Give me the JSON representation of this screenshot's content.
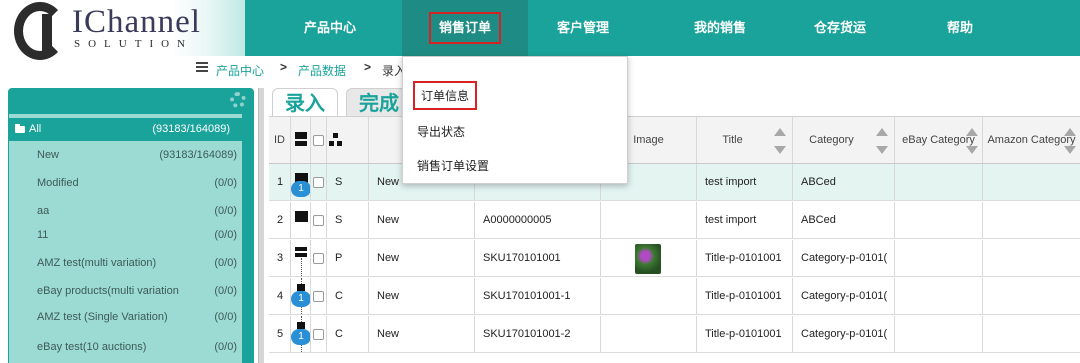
{
  "brand": {
    "name": "IChannel",
    "sub": "SOLUTION"
  },
  "nav": {
    "items": [
      {
        "label": "产品中心"
      },
      {
        "label": "销售订单"
      },
      {
        "label": "客户管理"
      },
      {
        "label": "我的销售"
      },
      {
        "label": "仓存货运"
      },
      {
        "label": "帮助"
      }
    ],
    "active_index": 1
  },
  "breadcrumb": {
    "items": [
      "产品中心",
      "产品数据",
      "录入"
    ],
    "separator": ">"
  },
  "dropdown": {
    "items": [
      "订单信息",
      "导出状态",
      "销售订单设置"
    ]
  },
  "sidebar": {
    "root": {
      "label": "All",
      "count": "(93183/164089)"
    },
    "items": [
      {
        "label": "New",
        "count": "(93183/164089)"
      },
      {
        "label": "Modified",
        "count": "(0/0)"
      },
      {
        "label": "aa",
        "count": "(0/0)"
      },
      {
        "label": "11",
        "count": "(0/0)"
      },
      {
        "label": "AMZ test(multi variation)",
        "count": "(0/0)"
      },
      {
        "label": "eBay products(multi variation",
        "count": "(0/0)"
      },
      {
        "label": "AMZ test (Single Variation)",
        "count": "(0/0)"
      },
      {
        "label": "eBay test(10 auctions)",
        "count": "(0/0)"
      }
    ]
  },
  "tabs": {
    "entry": "录入",
    "done": "完成"
  },
  "table": {
    "headers": {
      "id": "ID",
      "image": "Image",
      "title": "Title",
      "category": "Category",
      "ebay_category": "eBay Category",
      "amazon_category": "Amazon Category"
    },
    "rows": [
      {
        "id": "1",
        "pill": "1",
        "type": "S",
        "status": "New",
        "sku": "",
        "title": "test import",
        "category": "ABCed"
      },
      {
        "id": "2",
        "pill": "",
        "type": "S",
        "status": "New",
        "sku": "A0000000005",
        "title": "test import",
        "category": "ABCed"
      },
      {
        "id": "3",
        "pill": "",
        "type": "P",
        "status": "New",
        "sku": "SKU170101001",
        "title": "Title-p-0101001",
        "category": "Category-p-0101("
      },
      {
        "id": "4",
        "pill": "1",
        "type": "C",
        "status": "New",
        "sku": "SKU170101001-1",
        "title": "Title-p-0101001",
        "category": "Category-p-0101("
      },
      {
        "id": "5",
        "pill": "1",
        "type": "C",
        "status": "New",
        "sku": "SKU170101001-2",
        "title": "Title-p-0101001",
        "category": "Category-p-0101("
      }
    ]
  },
  "colors": {
    "brand": "#1aa39a",
    "highlight": "#d62222",
    "badge_blue": "#2b8fd6"
  }
}
